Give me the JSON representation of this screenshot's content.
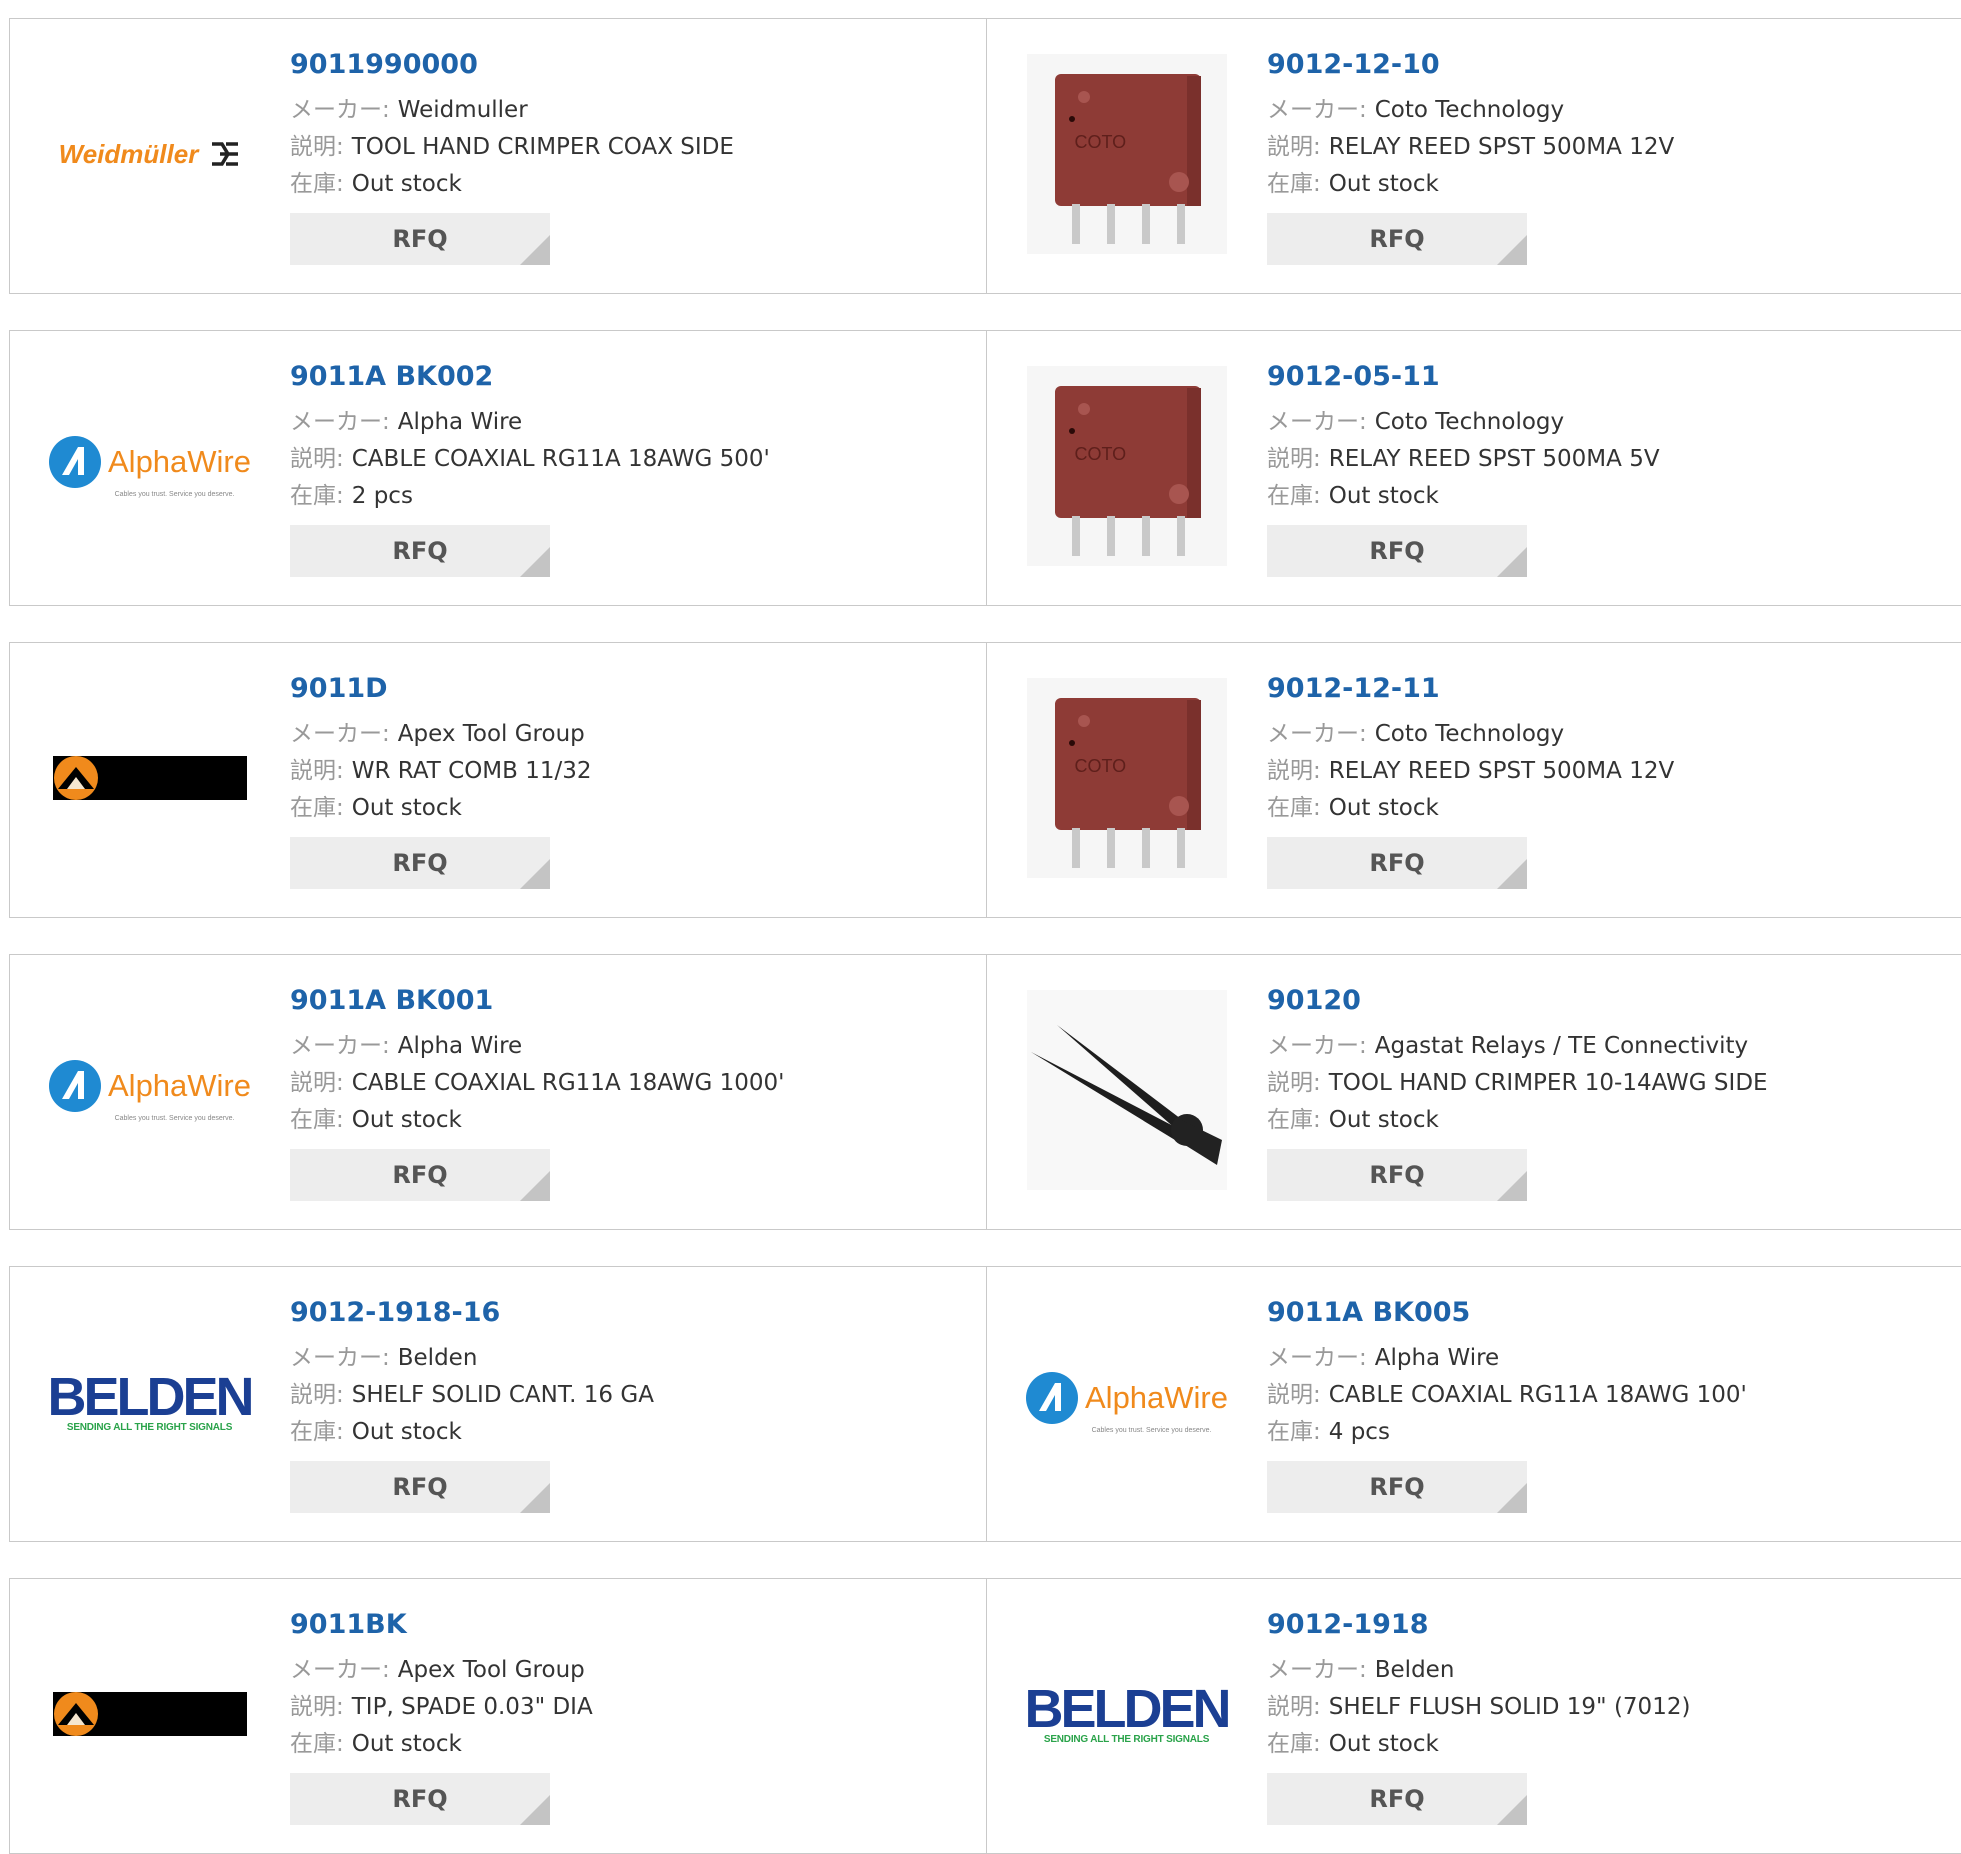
{
  "labels": {
    "maker": "メーカー:",
    "description": "説明:",
    "stock": "在庫:",
    "rfq": "RFQ"
  },
  "colors": {
    "link": "#1e63a9",
    "accent_orange": "#f08a1c",
    "alpha_blue": "#1f8ad2",
    "belden_blue": "#1b3f93",
    "belden_green": "#2aa34a",
    "relay_red": "#8e3b36"
  },
  "rows": [
    {
      "left": {
        "image": "weidmuller-logo",
        "logo_text": "Weidmüller",
        "part": "9011990000",
        "maker": "Weidmuller",
        "description": "TOOL HAND CRIMPER COAX SIDE",
        "stock": "Out stock"
      },
      "right": {
        "image": "relay-photo",
        "logo_text": "COTO",
        "part": "9012-12-10",
        "maker": "Coto Technology",
        "description": "RELAY REED SPST 500MA 12V",
        "stock": "Out stock"
      }
    },
    {
      "left": {
        "image": "alphawire-logo",
        "logo_text": "AlphaWire",
        "logo_tagline": "Cables you trust. Service you deserve.",
        "part": "9011A BK002",
        "maker": "Alpha Wire",
        "description": "CABLE COAXIAL RG11A 18AWG 500'",
        "stock": "2 pcs"
      },
      "right": {
        "image": "relay-photo",
        "logo_text": "COTO",
        "part": "9012-05-11",
        "maker": "Coto Technology",
        "description": "RELAY REED SPST 500MA 5V",
        "stock": "Out stock"
      }
    },
    {
      "left": {
        "image": "apex-logo",
        "part": "9011D",
        "maker": "Apex Tool Group",
        "description": "WR RAT COMB 11/32",
        "stock": "Out stock"
      },
      "right": {
        "image": "relay-photo",
        "logo_text": "COTO",
        "part": "9012-12-11",
        "maker": "Coto Technology",
        "description": "RELAY REED SPST 500MA 12V",
        "stock": "Out stock"
      }
    },
    {
      "left": {
        "image": "alphawire-logo",
        "logo_text": "AlphaWire",
        "logo_tagline": "Cables you trust. Service you deserve.",
        "part": "9011A BK001",
        "maker": "Alpha Wire",
        "description": "CABLE COAXIAL RG11A 18AWG 1000'",
        "stock": "Out stock"
      },
      "right": {
        "image": "crimper-photo",
        "part": "90120",
        "maker": "Agastat Relays / TE Connectivity",
        "description": "TOOL HAND CRIMPER 10-14AWG SIDE",
        "stock": "Out stock"
      }
    },
    {
      "left": {
        "image": "belden-logo",
        "logo_text": "BELDEN",
        "logo_tagline": "SENDING ALL THE RIGHT SIGNALS",
        "part": "9012-1918-16",
        "maker": "Belden",
        "description": "SHELF SOLID CANT. 16 GA",
        "stock": "Out stock"
      },
      "right": {
        "image": "alphawire-logo",
        "logo_text": "AlphaWire",
        "logo_tagline": "Cables you trust. Service you deserve.",
        "part": "9011A BK005",
        "maker": "Alpha Wire",
        "description": "CABLE COAXIAL RG11A 18AWG 100'",
        "stock": "4 pcs"
      }
    },
    {
      "left": {
        "image": "apex-logo",
        "part": "9011BK",
        "maker": "Apex Tool Group",
        "description": "TIP, SPADE 0.03\" DIA",
        "stock": "Out stock"
      },
      "right": {
        "image": "belden-logo",
        "logo_text": "BELDEN",
        "logo_tagline": "SENDING ALL THE RIGHT SIGNALS",
        "part": "9012-1918",
        "maker": "Belden",
        "description": "SHELF FLUSH SOLID 19\" (7012)",
        "stock": "Out stock"
      }
    }
  ]
}
